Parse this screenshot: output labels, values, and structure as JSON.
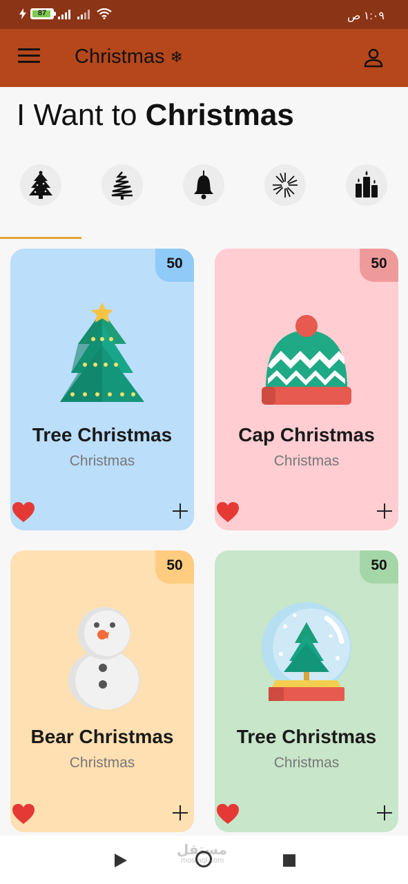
{
  "status_bar": {
    "battery": "87",
    "time": "١:٠٩ ص"
  },
  "app_bar": {
    "title": "Christmas",
    "title_symbol": "❄"
  },
  "heading": {
    "light": "I Want to",
    "bold": "Christmas"
  },
  "categories": [
    {
      "name": "christmas-tree",
      "icon": "decorated-tree-icon"
    },
    {
      "name": "pine-tree",
      "icon": "sketch-tree-icon"
    },
    {
      "name": "bell",
      "icon": "bell-icon"
    },
    {
      "name": "fireworks",
      "icon": "firework-icon"
    },
    {
      "name": "candles",
      "icon": "candles-icon"
    }
  ],
  "products": [
    {
      "name": "Tree Christmas",
      "category": "Christmas",
      "badge": "50",
      "bg": "#bbdefb",
      "badge_bg": "#90caf9",
      "art": "tree"
    },
    {
      "name": "Cap Christmas",
      "category": "Christmas",
      "badge": "50",
      "bg": "#ffcdd2",
      "badge_bg": "#ef9a9a",
      "art": "cap"
    },
    {
      "name": "Bear Christmas",
      "category": "Christmas",
      "badge": "50",
      "bg": "#ffe0b2",
      "badge_bg": "#ffcc80",
      "art": "snowman"
    },
    {
      "name": "Tree Christmas",
      "category": "Christmas",
      "badge": "50",
      "bg": "#c8e6c9",
      "badge_bg": "#a5d6a7",
      "art": "globe"
    }
  ],
  "watermark": {
    "text": "مستقل",
    "sub": "mostaql.com"
  },
  "colors": {
    "status_bar": "#8c3416",
    "app_bar": "#b5471b",
    "underline": "#e2a43a",
    "heart": "#e53935"
  }
}
